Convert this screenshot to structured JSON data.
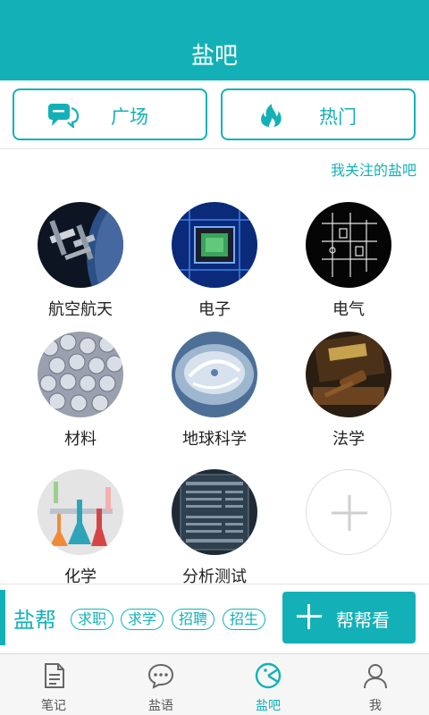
{
  "header": {
    "title": "盐吧"
  },
  "top_buttons": {
    "square": {
      "label": "广场",
      "icon": "chat-bubbles-icon"
    },
    "hot": {
      "label": "热门",
      "icon": "flame-icon"
    }
  },
  "follow_link": "我关注的盐吧",
  "categories": [
    {
      "name": "航空航天",
      "icon": "space-station-photo"
    },
    {
      "name": "电子",
      "icon": "circuit-chip-photo"
    },
    {
      "name": "电气",
      "icon": "electrical-diagram-photo"
    },
    {
      "name": "材料",
      "icon": "crystals-photo"
    },
    {
      "name": "地球科学",
      "icon": "hurricane-photo"
    },
    {
      "name": "法学",
      "icon": "law-gavel-photo"
    },
    {
      "name": "化学",
      "icon": "lab-flasks-illustration"
    },
    {
      "name": "分析测试",
      "icon": "instrument-screen-photo"
    }
  ],
  "add_category": {
    "icon": "plus-icon"
  },
  "helper": {
    "title": "盐帮",
    "tags": [
      "求职",
      "求学",
      "招聘",
      "招生"
    ],
    "button_label": "帮帮看"
  },
  "tabbar": {
    "items": [
      {
        "label": "笔记",
        "icon": "note-icon"
      },
      {
        "label": "盐语",
        "icon": "chat-icon"
      },
      {
        "label": "盐吧",
        "icon": "salt-bar-icon"
      },
      {
        "label": "我",
        "icon": "person-icon"
      }
    ],
    "active_index": 2
  },
  "colors": {
    "accent": "#13b1b7",
    "tab_inactive": "#555555"
  }
}
